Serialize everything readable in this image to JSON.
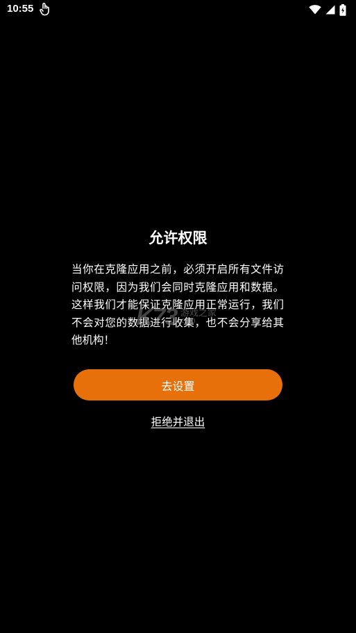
{
  "status_bar": {
    "time": "10:55",
    "icons": [
      "touch-icon",
      "wifi-icon",
      "signal-icon",
      "battery-icon"
    ]
  },
  "dialog": {
    "title": "允许权限",
    "message": "当你在克隆应用之前，必须开启所有文件访问权限，因为我们会同时克隆应用和数据。这样我们才能保证克隆应用正常运行，我们不会对您的数据进行收集，也不会分享给其他机构！",
    "primary_button_label": "去设置",
    "secondary_link_label": "拒绝并退出"
  },
  "watermark": {
    "logo_text": "K73",
    "sub_text": "游戏之家",
    "domain_text": ".com"
  },
  "colors": {
    "background": "#000000",
    "accent": "#e8700b",
    "text": "#ffffff"
  }
}
